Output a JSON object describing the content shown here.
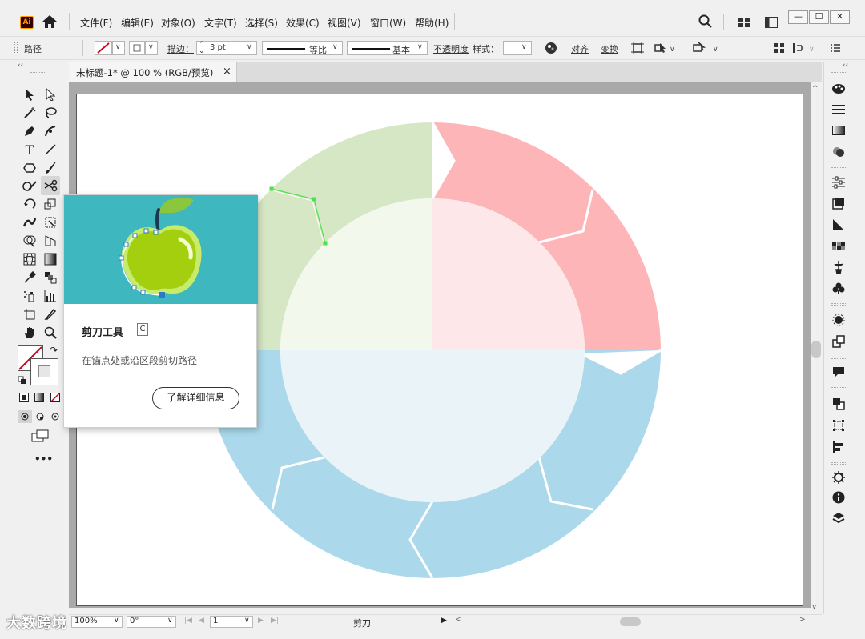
{
  "app": {
    "logo_text": "Ai",
    "accent": "#ff9a00"
  },
  "menubar": {
    "items": [
      "文件(F)",
      "编辑(E)",
      "对象(O)",
      "文字(T)",
      "选择(S)",
      "效果(C)",
      "视图(V)",
      "窗口(W)",
      "帮助(H)"
    ]
  },
  "window_controls": {
    "minimize": "—",
    "maximize": "☐",
    "close": "✕"
  },
  "control_bar": {
    "object_type": "路径",
    "stroke_label": "描边：",
    "stroke_weight": "3 pt",
    "profile_label": "等比",
    "brush_label": "基本",
    "opacity_label": "不透明度",
    "style_label": "样式：",
    "align_label": "对齐",
    "transform_label": "变换"
  },
  "document": {
    "tab_title": "未标题-1* @ 100 % (RGB/预览)",
    "tab_close": "×"
  },
  "status_bar": {
    "zoom": "100%",
    "rotation": "0°",
    "artboard_number": "1",
    "current_tool": "剪刀"
  },
  "tooltip": {
    "title": "剪刀工具",
    "shortcut": "C",
    "description": "在锚点处或沿区段剪切路径",
    "learn_more": "了解详细信息"
  },
  "artwork": {
    "colors": {
      "green_outer": "#d5e7c4",
      "green_inner": "#f3f8ec",
      "red_outer": "#fdb5b7",
      "red_inner": "#fde7e8",
      "blue_outer": "#abd9eb",
      "blue_inner": "#eaf4f8",
      "selection": "#4ee04e"
    }
  },
  "watermark": "大数跨境"
}
